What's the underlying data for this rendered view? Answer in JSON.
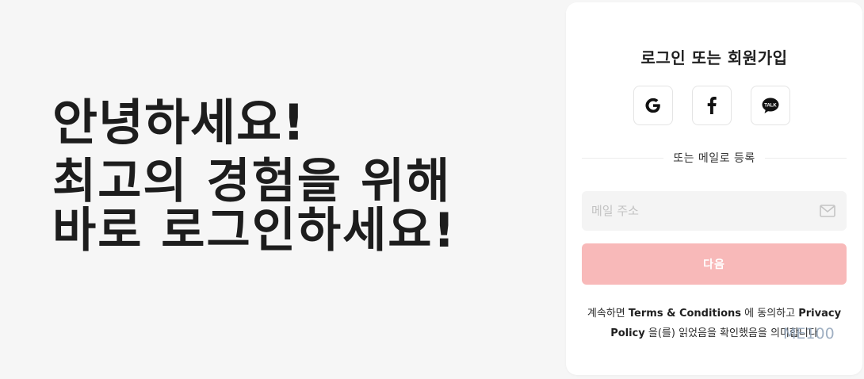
{
  "hero": {
    "line1": "안녕하세요!",
    "line2": "최고의 경험을 위해",
    "line3": "바로 로그인하세요!"
  },
  "login": {
    "title": "로그인 또는 회원가입",
    "social": [
      {
        "name": "google",
        "icon": "google-icon"
      },
      {
        "name": "facebook",
        "icon": "facebook-icon"
      },
      {
        "name": "kakaotalk",
        "icon": "kakaotalk-icon",
        "badge": "TALK"
      }
    ],
    "divider_text": "또는 메일로 등록",
    "email_placeholder": "메일 주소",
    "next_label": "다음",
    "terms": {
      "prefix": "계속하면 ",
      "terms_link": "Terms & Conditions",
      "middle": " 에 동의하고 ",
      "privacy_link": "Privacy Policy",
      "suffix": " 을(를) 읽었음을 확인했음을 의미합니다"
    }
  },
  "watermark": "ME100",
  "colors": {
    "background": "#f6f6f6",
    "card": "#ffffff",
    "next_button": "#f8b9b9",
    "input_bg": "#f4f4f4",
    "text_dark": "#1d1d1d"
  }
}
